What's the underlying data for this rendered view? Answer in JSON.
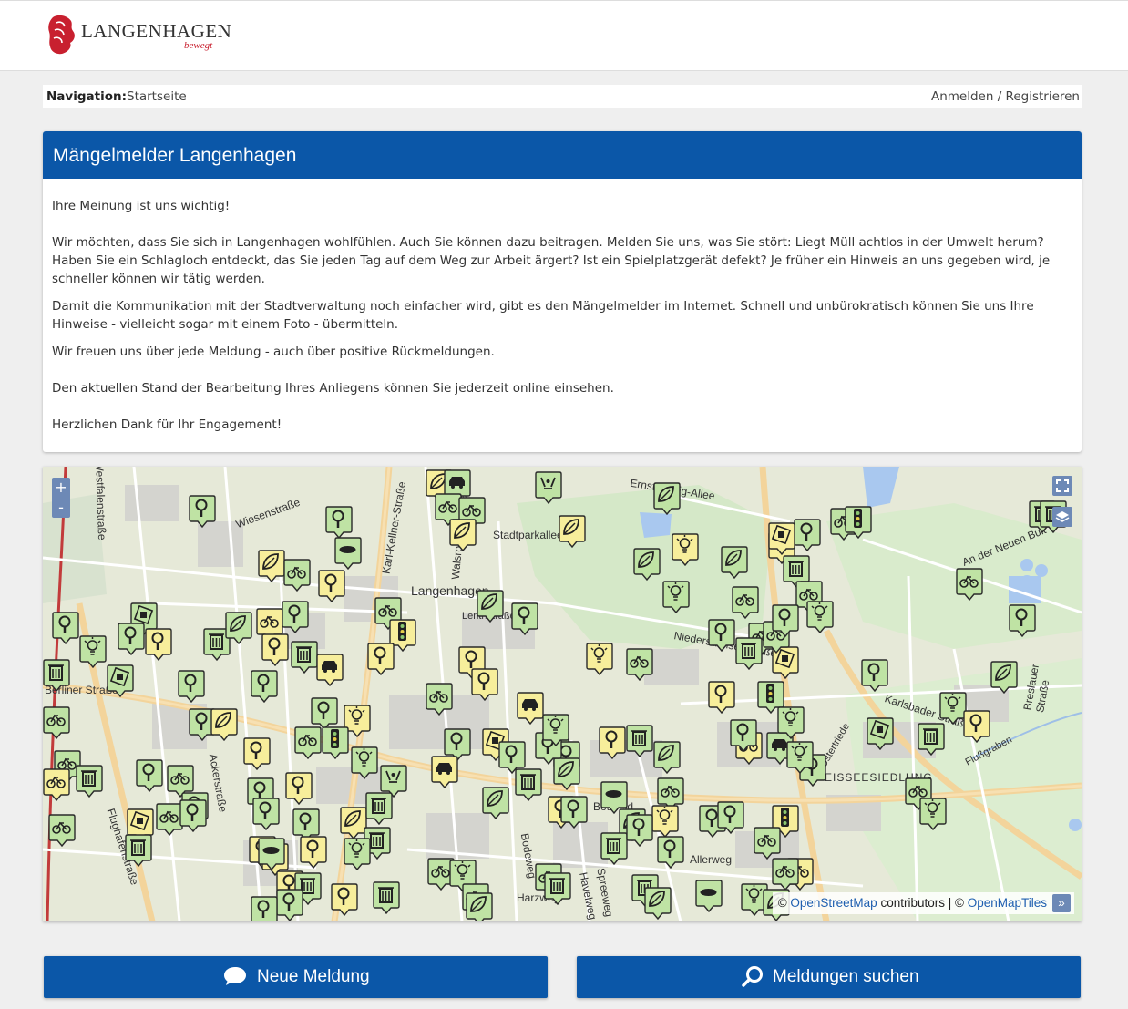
{
  "header": {
    "logo_name": "LANGENHAGEN",
    "logo_tagline": "bewegt",
    "colors": {
      "brand_red": "#c8202f",
      "brand_blue": "#0b57a8"
    }
  },
  "nav": {
    "label": "Navigation:",
    "home": "Startseite",
    "auth": "Anmelden / Registrieren"
  },
  "intro": {
    "title": "Mängelmelder Langenhagen",
    "paragraphs": [
      "Ihre Meinung ist uns wichtig!",
      "Wir möchten, dass Sie sich in Langenhagen wohlfühlen. Auch Sie können dazu beitragen. Melden Sie uns, was Sie stört: Liegt Müll achtlos in der Umwelt herum? Haben Sie ein Schlagloch entdeckt, das Sie jeden Tag auf dem Weg zur Arbeit ärgert? Ist ein Spielplatzgerät defekt? Je früher ein Hinweis an uns gegeben wird, je schneller können wir tätig werden.",
      "Damit die Kommunikation mit der Stadtverwaltung noch einfacher wird, gibt es den Mängelmelder im Internet. Schnell und unbürokratisch können Sie uns Ihre Hinweise - vielleicht sogar mit einem Foto - übermitteln.",
      "Wir freuen uns über jede Meldung - auch über positive Rückmeldungen.",
      "Den aktuellen Stand der Bearbeitung Ihres Anliegens können Sie jederzeit online einsehen.",
      "Herzlichen Dank für Ihr Engagement!"
    ]
  },
  "map": {
    "zoom_in": "+",
    "zoom_out": "-",
    "fullscreen_icon": "fullscreen-icon",
    "layers_icon": "layers-icon",
    "attribution": {
      "prefix": "© ",
      "osm": "OpenStreetMap",
      "middle": " contributors | © ",
      "tiles": "OpenMapTiles",
      "more": "»"
    },
    "labels": [
      "Langenhagen",
      "Stadtparkallee",
      "Ernst-Nebig-Allee",
      "An der Neuen Bult",
      "Niedersachsenstraße",
      "Karlsbader Straße",
      "Flußgraben",
      "Breslauer Straße",
      "Allerweg",
      "Bodeweg",
      "Spreeweg",
      "Havelweg",
      "Harzweg",
      "Ackerstraße",
      "Flughafenstraße",
      "Karl-Kellner-Straße",
      "Walsroder Straße",
      "Westfalenstraße",
      "Wiesenstraße",
      "EISSEESIEDLUNG",
      "Berliner Straße",
      "Lenthstraße",
      "Bothfeld",
      "Ostertriede"
    ],
    "marker_colors": {
      "open": "#f7ee9b",
      "in_progress": "#bfe3a4",
      "border": "#2a2a2a"
    }
  },
  "actions": {
    "new_report": "Neue Meldung",
    "search_reports": "Meldungen suchen"
  }
}
